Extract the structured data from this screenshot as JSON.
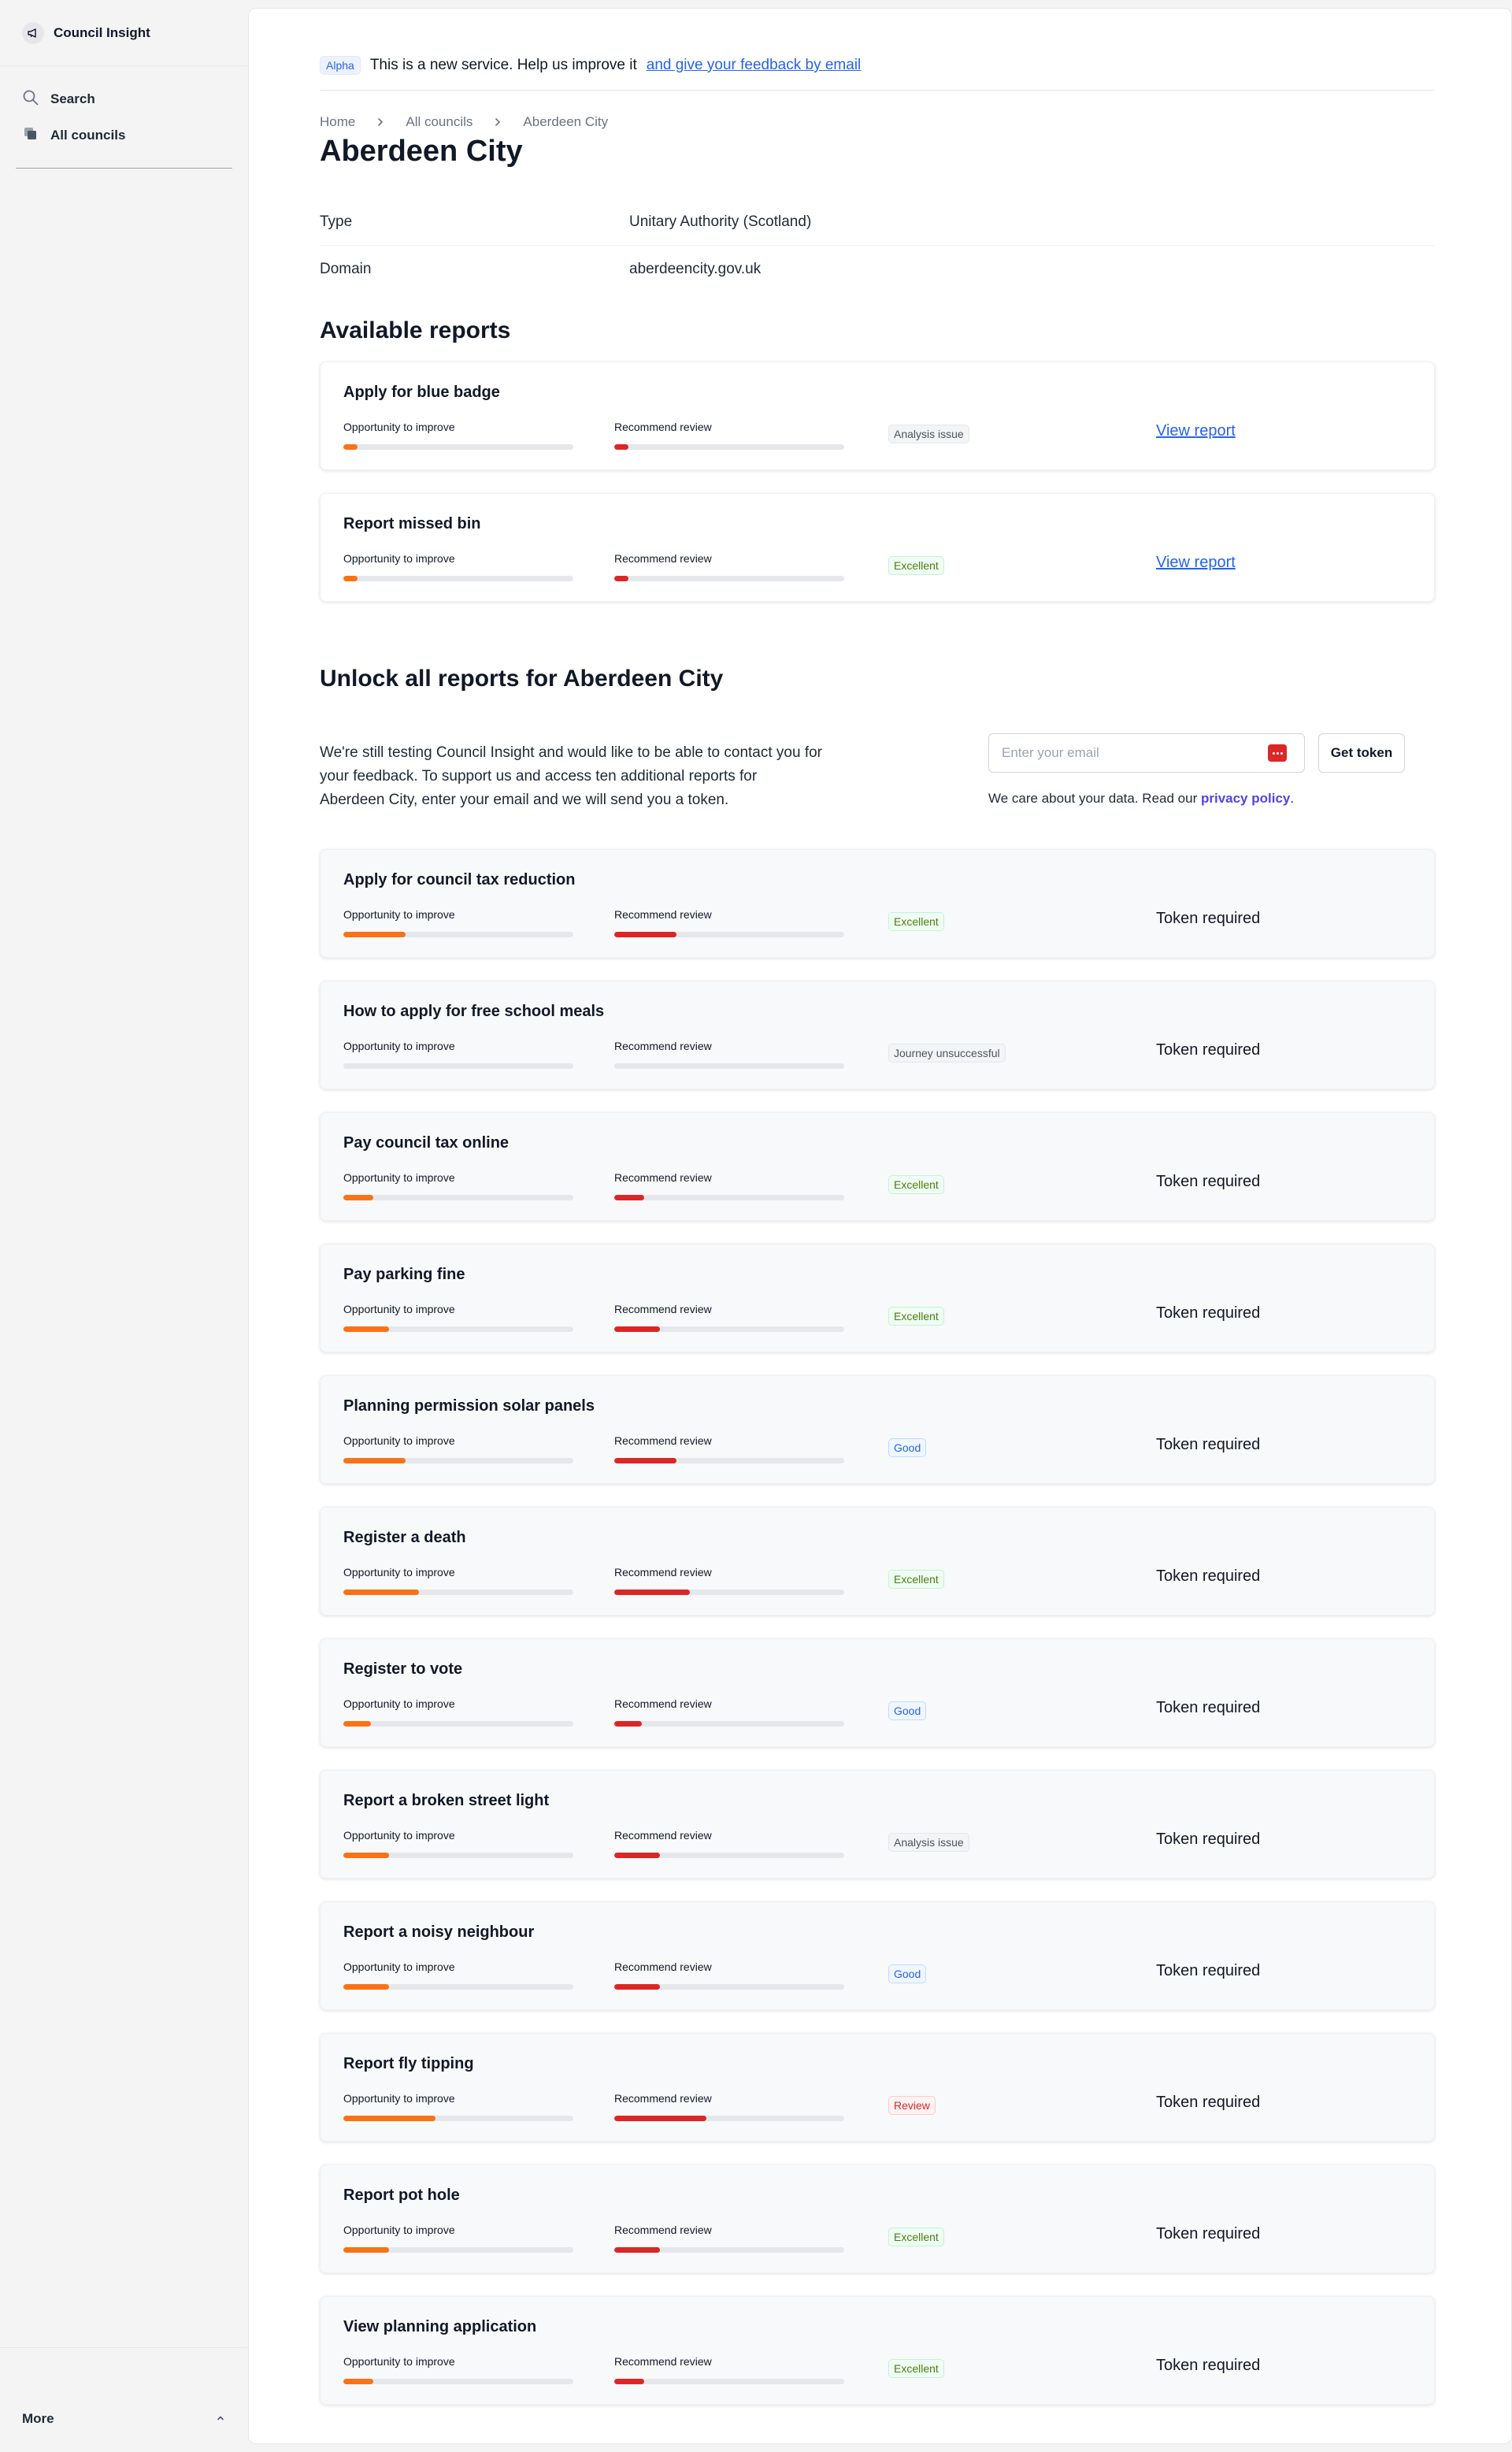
{
  "sidebar": {
    "brand": "Council Insight",
    "items": [
      {
        "label": "Search"
      },
      {
        "label": "All councils"
      }
    ],
    "more_label": "More"
  },
  "banner": {
    "tag": "Alpha",
    "text": "This is a new service. Help us improve it",
    "link": "and give your feedback by email"
  },
  "breadcrumb": [
    "Home",
    "All councils",
    "Aberdeen City"
  ],
  "page_title": "Aberdeen City",
  "meta": [
    {
      "key": "Type",
      "value": "Unitary Authority (Scotland)"
    },
    {
      "key": "Domain",
      "value": "aberdeencity.gov.uk"
    }
  ],
  "available_title": "Available reports",
  "unlock_title": "Unlock all reports for Aberdeen City",
  "unlock_text": "We're still testing Council Insight and would like to be able to contact you for your feedback. To support us and access ten additional reports for Aberdeen City, enter your email and we will send you a token.",
  "email_placeholder": "Enter your email",
  "get_token_label": "Get token",
  "privacy_text": "We care about your data. Read our ",
  "privacy_link": "privacy policy",
  "privacy_end": ".",
  "metric_labels": {
    "opportunity": "Opportunity to improve",
    "recommend": "Recommend review"
  },
  "badge_styles": {
    "Analysis issue": {
      "bg": "#f3f4f6",
      "fg": "#4b5563",
      "border": "#e5e7eb"
    },
    "Excellent": {
      "bg": "#f0fdf4",
      "fg": "#4d7c0f",
      "border": "#bbf7d0"
    },
    "Journey unsuccessful": {
      "bg": "#f3f4f6",
      "fg": "#4b5563",
      "border": "#e5e7eb"
    },
    "Good": {
      "bg": "#eff6ff",
      "fg": "#2563eb",
      "border": "#bfdbfe"
    },
    "Review": {
      "bg": "#fef2f2",
      "fg": "#dc2626",
      "border": "#fecaca"
    }
  },
  "available_reports": [
    {
      "title": "Apply for blue badge",
      "opportunity": 0.06,
      "recommend": 0.06,
      "status": "Analysis issue",
      "action": "View report"
    },
    {
      "title": "Report missed bin",
      "opportunity": 0.06,
      "recommend": 0.06,
      "status": "Excellent",
      "action": "View report"
    }
  ],
  "locked_reports": [
    {
      "title": "Apply for council tax reduction",
      "opportunity": 0.27,
      "recommend": 0.27,
      "status": "Excellent",
      "action": "Token required"
    },
    {
      "title": "How to apply for free school meals",
      "opportunity": 0.0,
      "recommend": 0.0,
      "status": "Journey unsuccessful",
      "action": "Token required"
    },
    {
      "title": "Pay council tax online",
      "opportunity": 0.13,
      "recommend": 0.13,
      "status": "Excellent",
      "action": "Token required"
    },
    {
      "title": "Pay parking fine",
      "opportunity": 0.2,
      "recommend": 0.2,
      "status": "Excellent",
      "action": "Token required"
    },
    {
      "title": "Planning permission solar panels",
      "opportunity": 0.27,
      "recommend": 0.27,
      "status": "Good",
      "action": "Token required"
    },
    {
      "title": "Register a death",
      "opportunity": 0.33,
      "recommend": 0.33,
      "status": "Excellent",
      "action": "Token required"
    },
    {
      "title": "Register to vote",
      "opportunity": 0.12,
      "recommend": 0.12,
      "status": "Good",
      "action": "Token required"
    },
    {
      "title": "Report a broken street light",
      "opportunity": 0.2,
      "recommend": 0.2,
      "status": "Analysis issue",
      "action": "Token required"
    },
    {
      "title": "Report a noisy neighbour",
      "opportunity": 0.2,
      "recommend": 0.2,
      "status": "Good",
      "action": "Token required"
    },
    {
      "title": "Report fly tipping",
      "opportunity": 0.4,
      "recommend": 0.4,
      "status": "Review",
      "action": "Token required"
    },
    {
      "title": "Report pot hole",
      "opportunity": 0.2,
      "recommend": 0.2,
      "status": "Excellent",
      "action": "Token required"
    },
    {
      "title": "View planning application",
      "opportunity": 0.13,
      "recommend": 0.13,
      "status": "Excellent",
      "action": "Token required"
    }
  ]
}
